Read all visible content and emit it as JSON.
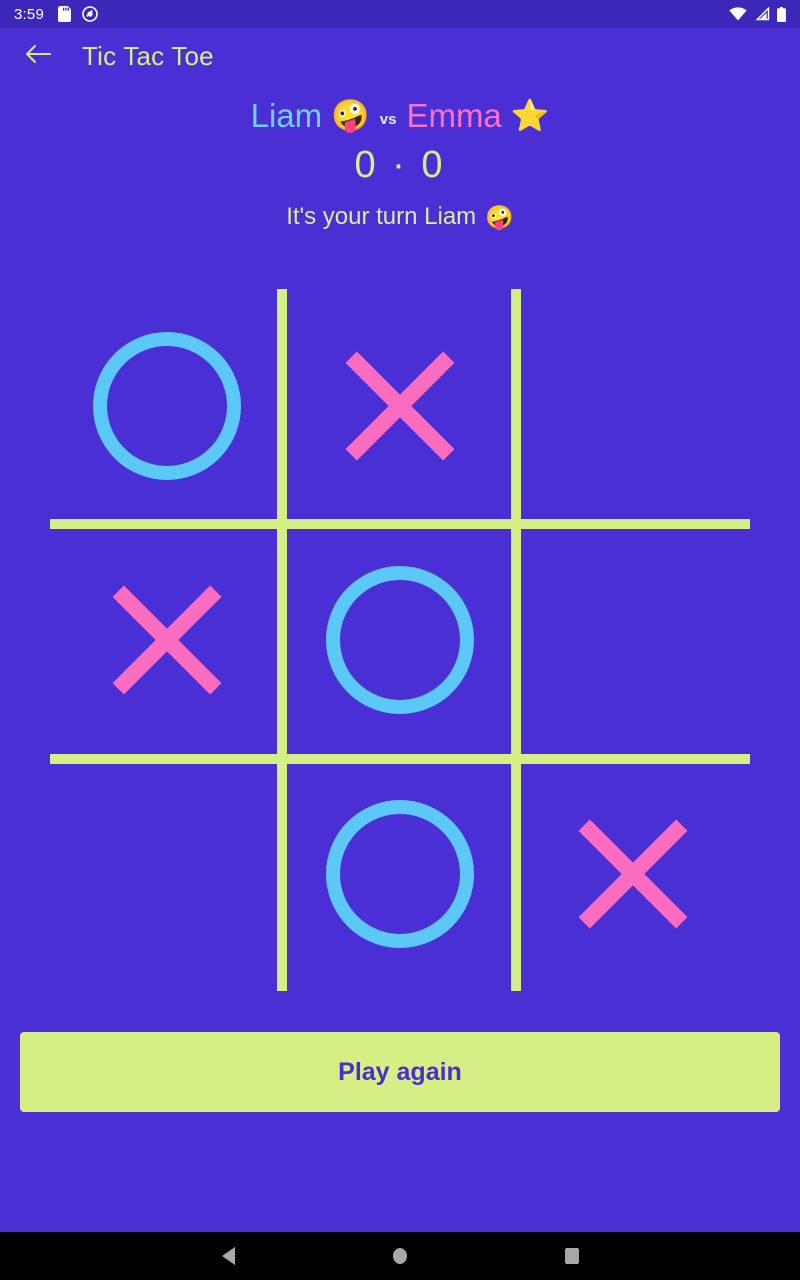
{
  "status_bar": {
    "clock": "3:59",
    "left_icons": [
      "sd-card-icon",
      "do-not-disturb-icon"
    ],
    "right_icons": [
      "wifi-icon",
      "cellular-signal-icon",
      "battery-icon"
    ],
    "background": "#3b28b8"
  },
  "app_bar": {
    "back_icon": "back-arrow-icon",
    "title": "Tic Tac Toe",
    "title_color": "#d4ef84",
    "background": "#4a30d4"
  },
  "scoreboard": {
    "player_one": {
      "name": "Liam",
      "emoji": "🤪",
      "color": "#6fd0f5"
    },
    "versus": "vs",
    "player_two": {
      "name": "Emma",
      "emoji": "⭐",
      "color": "#ff6ec7"
    },
    "score": "0 · 0",
    "score_color": "#d4ef84",
    "turn_text": "It's your turn Liam",
    "turn_emoji": "🤪"
  },
  "board": {
    "grid_color": "#d4ef84",
    "o_color": "#5cc8f7",
    "x_color": "#fa6cbf",
    "cells": [
      {
        "index": 0,
        "mark": "O"
      },
      {
        "index": 1,
        "mark": "X"
      },
      {
        "index": 2,
        "mark": ""
      },
      {
        "index": 3,
        "mark": "X"
      },
      {
        "index": 4,
        "mark": "O"
      },
      {
        "index": 5,
        "mark": ""
      },
      {
        "index": 6,
        "mark": ""
      },
      {
        "index": 7,
        "mark": "O"
      },
      {
        "index": 8,
        "mark": "X"
      }
    ]
  },
  "actions": {
    "play_again_label": "Play again",
    "play_again_bg": "#d4ef84",
    "play_again_text_color": "#4a2ed0"
  },
  "nav_bar": {
    "back_icon": "nav-back-triangle-icon",
    "home_icon": "nav-home-circle-icon",
    "recents_icon": "nav-recents-square-icon",
    "background": "#000000"
  },
  "page_background": "#4a30d4"
}
